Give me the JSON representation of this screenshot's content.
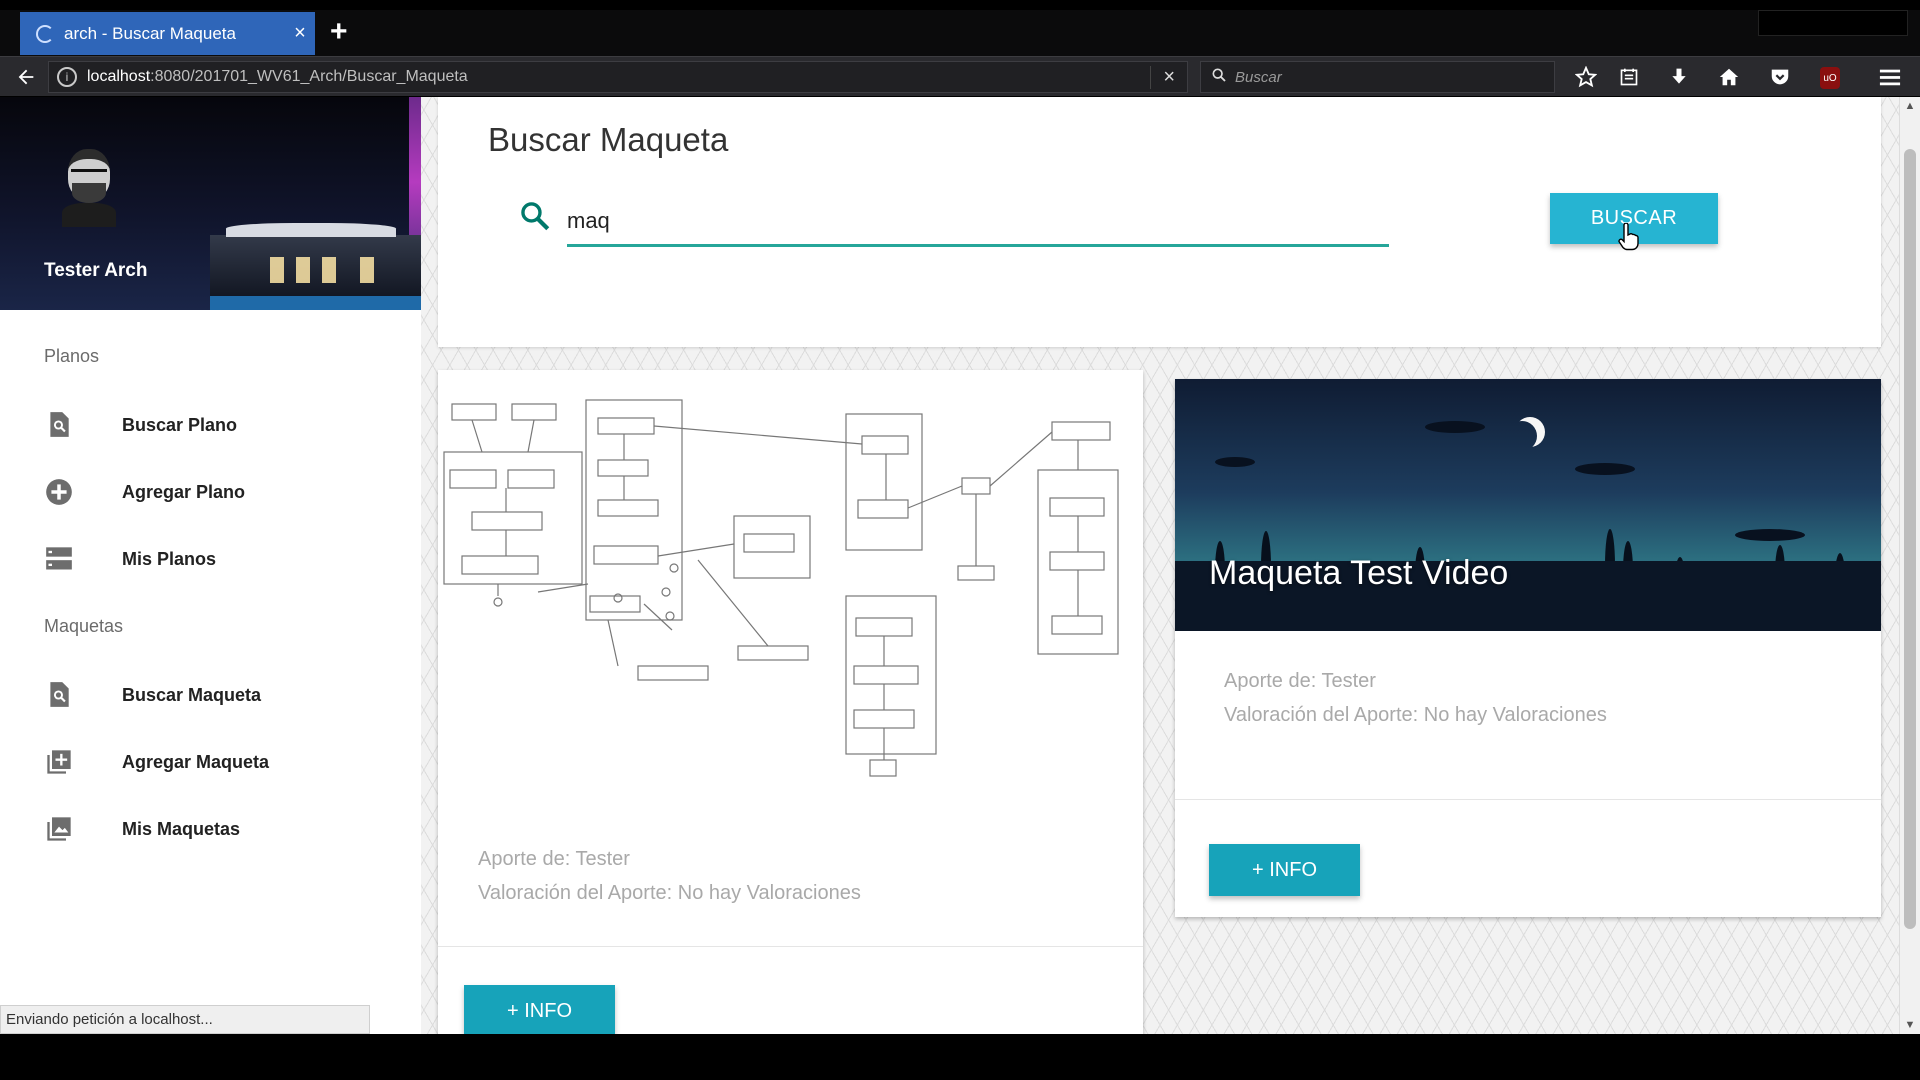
{
  "browser": {
    "tab_title": "arch - Buscar Maqueta",
    "tab_close": "×",
    "new_tab": "+",
    "url_host": "localhost",
    "url_path": ":8080/201701_WV61_Arch/Buscar_Maqueta",
    "url_clear": "×",
    "search_placeholder": "Buscar",
    "toolbar_icons": [
      "star-icon",
      "reading-list-icon",
      "download-icon",
      "home-icon",
      "pocket-icon",
      "ublock-icon",
      "menu-icon"
    ]
  },
  "sidebar": {
    "user_name": "Tester Arch",
    "sections": [
      {
        "title": "Planos",
        "items": [
          {
            "label": "Buscar Plano",
            "icon": "find-in-page-icon"
          },
          {
            "label": "Agregar Plano",
            "icon": "add-circle-icon"
          },
          {
            "label": "Mis Planos",
            "icon": "storage-icon"
          }
        ]
      },
      {
        "title": "Maquetas",
        "items": [
          {
            "label": "Buscar Maqueta",
            "icon": "find-in-page-icon"
          },
          {
            "label": "Agregar Maqueta",
            "icon": "add-to-photos-icon"
          },
          {
            "label": "Mis Maquetas",
            "icon": "photo-library-icon"
          }
        ]
      }
    ]
  },
  "main": {
    "page_title": "Buscar Maqueta",
    "search_value": "maq",
    "search_button": "BUSCAR",
    "results": [
      {
        "title": "",
        "author": "Aporte de: Tester",
        "rating": "Valoración del Aporte: No hay Valoraciones",
        "button": "+ INFO"
      },
      {
        "title": "Maqueta Test Video",
        "author": "Aporte de: Tester",
        "rating": "Valoración del Aporte: No hay Valoraciones",
        "button": "+ INFO"
      }
    ]
  },
  "status_bar": "Enviando petición a localhost...",
  "colors": {
    "accent_teal": "#26a69a",
    "buscar_button": "#26b4d2",
    "info_button": "#17a3ba",
    "tab_active": "#2f66b9"
  }
}
